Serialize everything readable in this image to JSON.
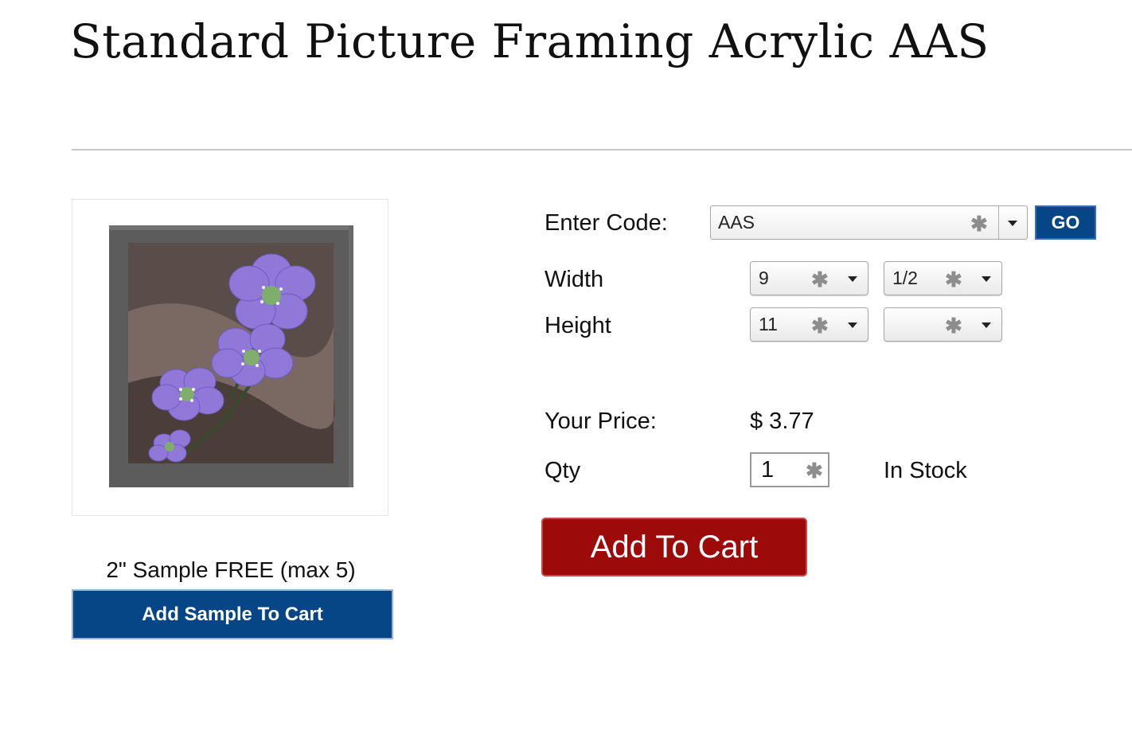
{
  "product": {
    "title": "Standard Picture Framing Acrylic AAS"
  },
  "sample": {
    "label": "2\" Sample FREE (max 5)",
    "button_label": "Add Sample To Cart"
  },
  "code": {
    "label": "Enter Code:",
    "value": "AAS",
    "go_label": "GO"
  },
  "size": {
    "width_label": "Width",
    "height_label": "Height",
    "width_whole": "9",
    "width_fraction": "1/2",
    "height_whole": "11",
    "height_fraction": ""
  },
  "pricing": {
    "label": "Your Price:",
    "value": "$ 3.77"
  },
  "quantity": {
    "label": "Qty",
    "value": "1",
    "stock_status": "In Stock"
  },
  "cart": {
    "button_label": "Add To Cart"
  },
  "icons": {
    "required": "asterisk-icon",
    "dropdown": "caret-down-icon"
  },
  "colors": {
    "primary_blue": "#064686",
    "cart_red": "#9c0a0a"
  }
}
